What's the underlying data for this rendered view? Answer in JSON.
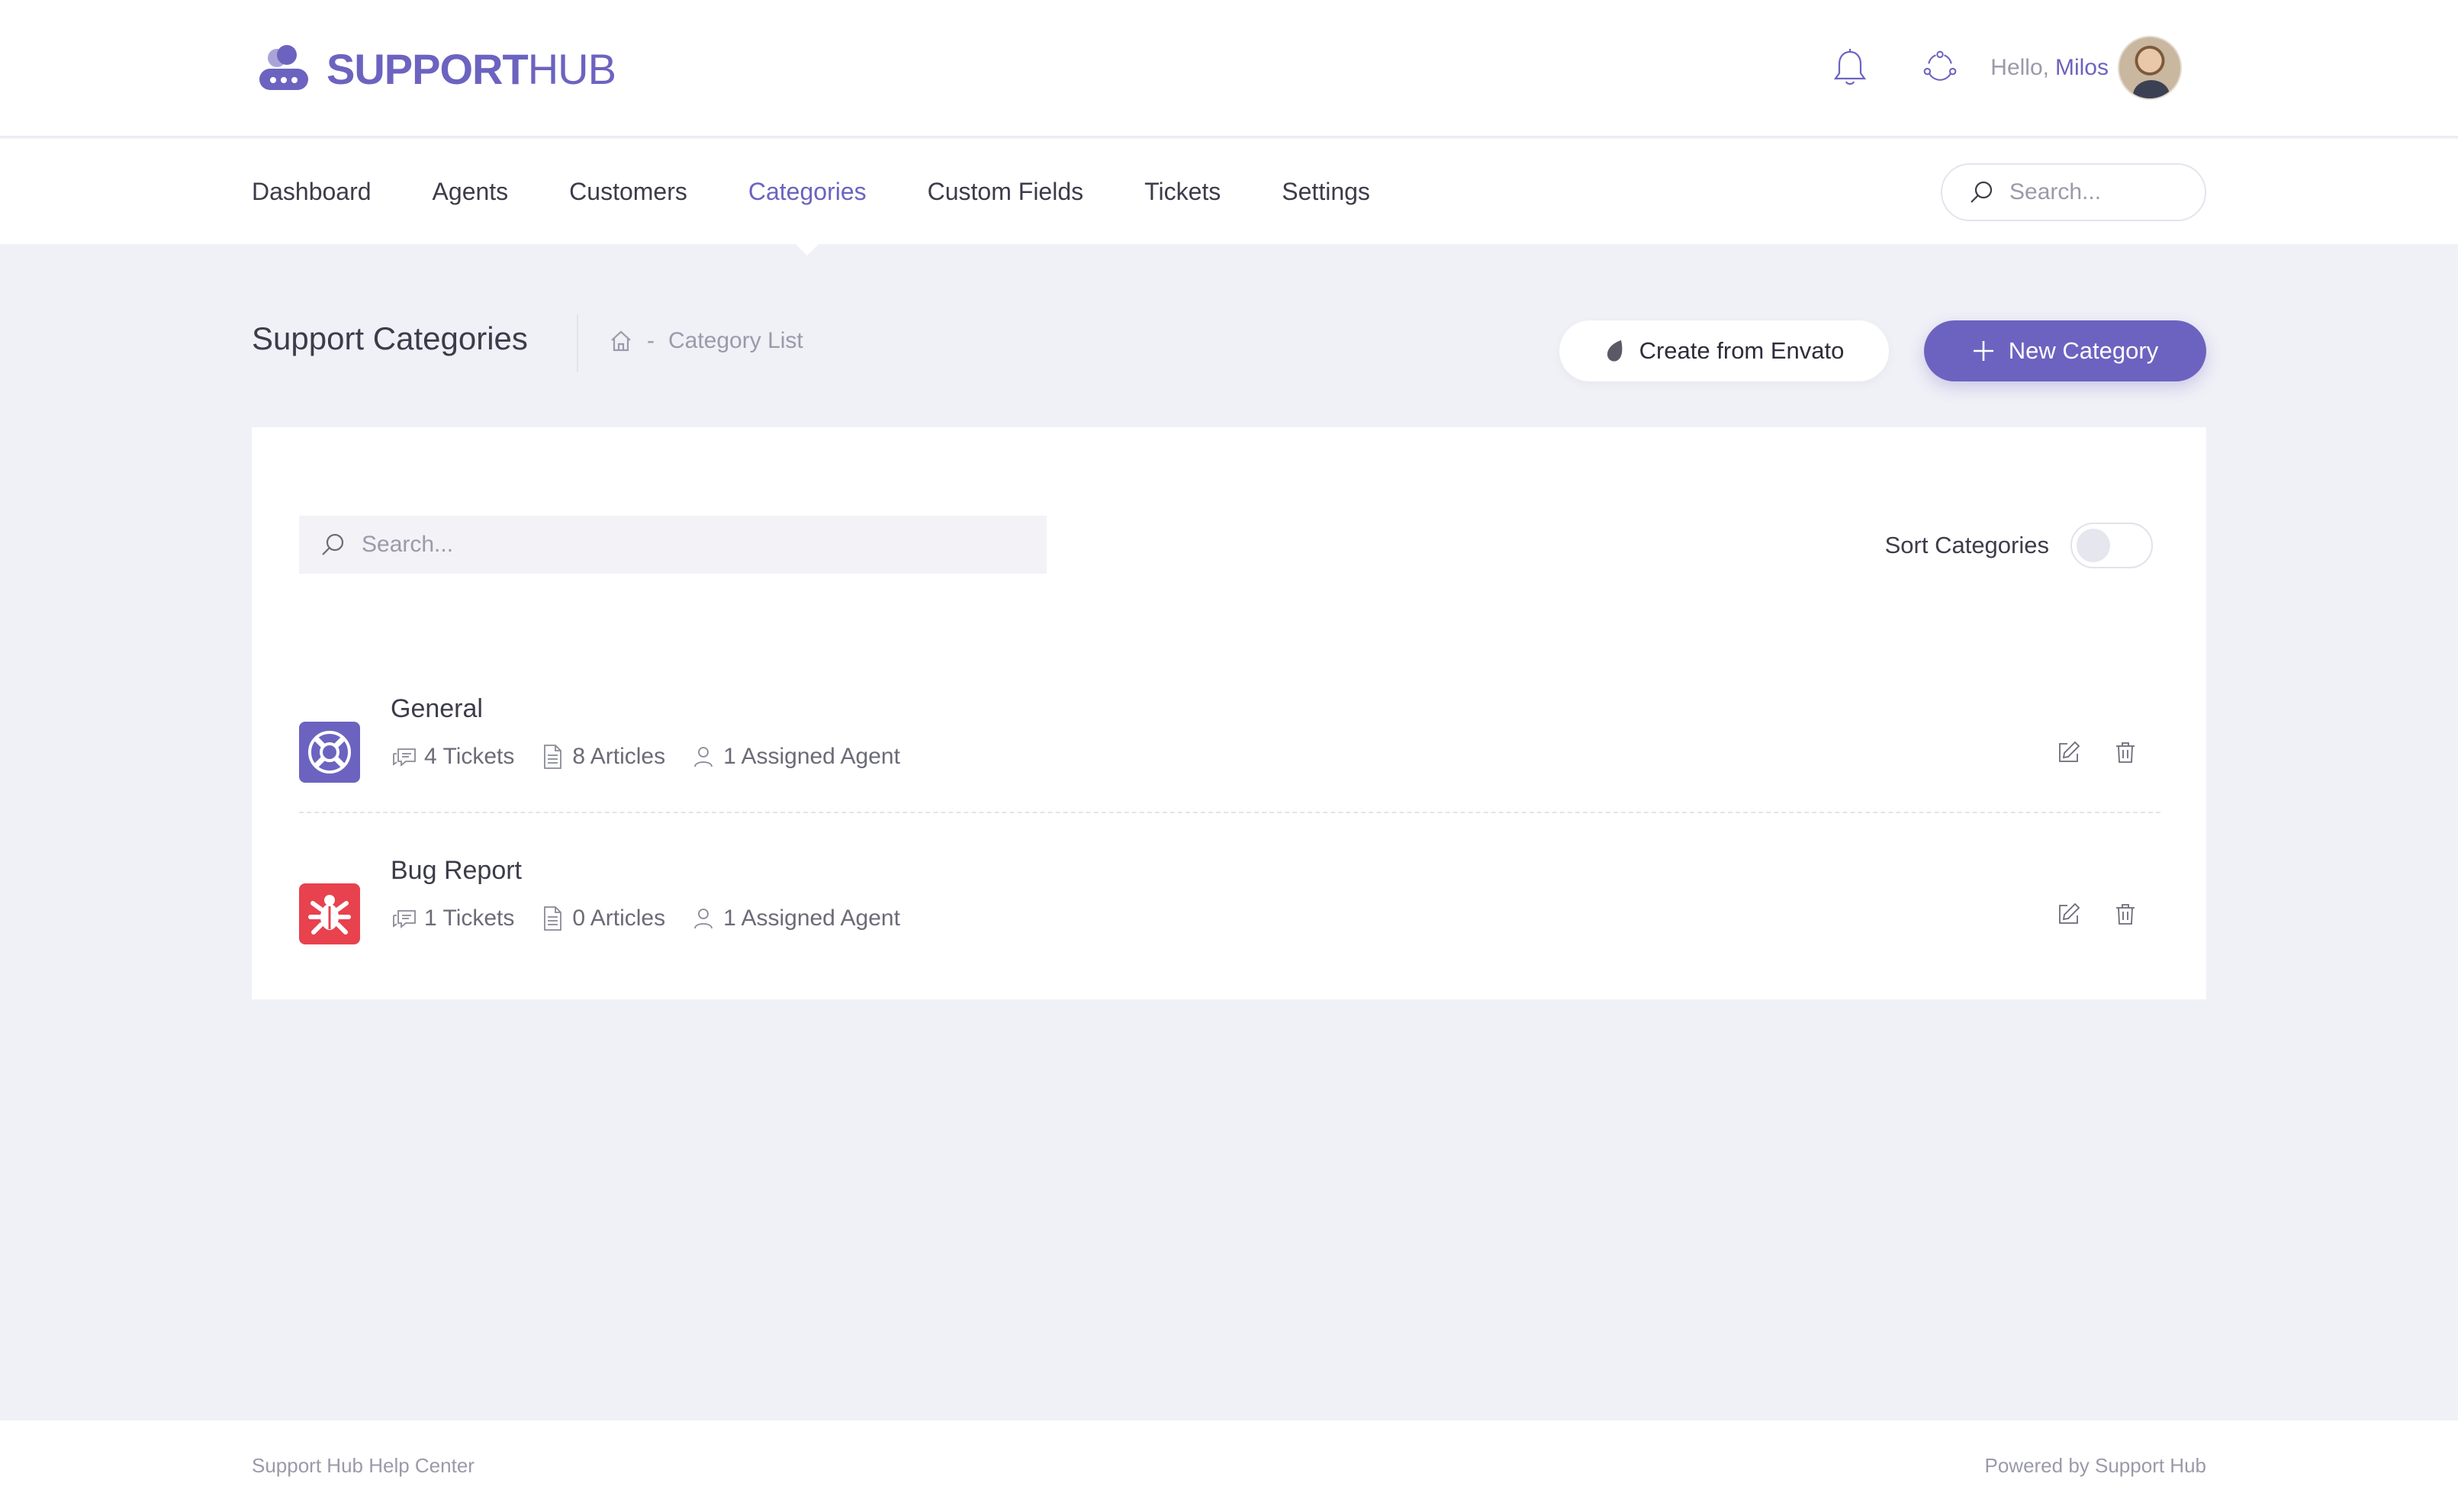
{
  "brand": {
    "name_bold": "SUPPORT",
    "name_light": "HUB"
  },
  "header": {
    "greeting": "Hello,",
    "user_name": "Milos",
    "icons": [
      "bell-icon",
      "hub-network-icon"
    ]
  },
  "nav": {
    "items": [
      {
        "label": "Dashboard",
        "active": false
      },
      {
        "label": "Agents",
        "active": false
      },
      {
        "label": "Customers",
        "active": false
      },
      {
        "label": "Categories",
        "active": true
      },
      {
        "label": "Custom Fields",
        "active": false
      },
      {
        "label": "Tickets",
        "active": false
      },
      {
        "label": "Settings",
        "active": false
      }
    ],
    "search_placeholder": "Search..."
  },
  "page": {
    "title": "Support Categories",
    "breadcrumb_separator": "-",
    "breadcrumb_current": "Category List",
    "btn_envato": "Create from Envato",
    "btn_new": "New Category"
  },
  "list": {
    "search_placeholder": "Search...",
    "sort_label": "Sort Categories",
    "sort_enabled": false,
    "categories": [
      {
        "name": "General",
        "icon": "lifebuoy-icon",
        "color": "#6c63c0",
        "tickets": "4 Tickets",
        "articles": "8 Articles",
        "agents": "1 Assigned Agent"
      },
      {
        "name": "Bug Report",
        "icon": "bug-icon",
        "color": "#e8424e",
        "tickets": "1 Tickets",
        "articles": "0 Articles",
        "agents": "1 Assigned Agent"
      }
    ]
  },
  "footer": {
    "left": "Support Hub Help Center",
    "right": "Powered by Support Hub"
  },
  "colors": {
    "accent": "#6c63c0",
    "danger": "#e8424e",
    "background": "#f0f0f7"
  }
}
